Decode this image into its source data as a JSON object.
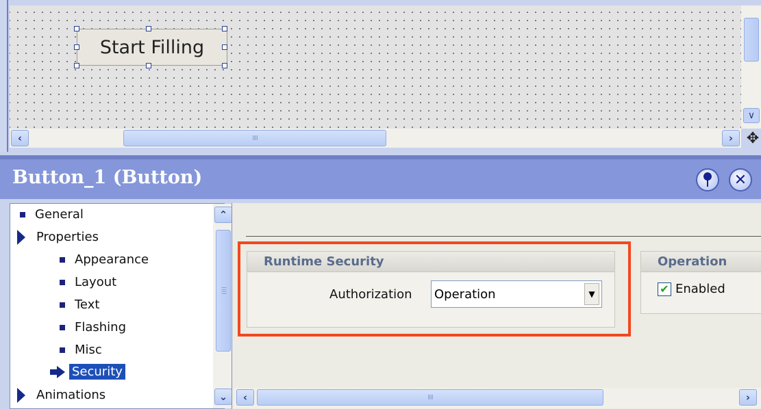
{
  "editor": {
    "canvas_button_label": "Start Filling",
    "scroll_grip": "IIII"
  },
  "panel": {
    "title": "Button_1 (Button)",
    "pin_icon": "pin-icon",
    "close_icon": "close-icon"
  },
  "tree": {
    "items": [
      {
        "label": "General",
        "icon": "bullet",
        "level": 0
      },
      {
        "label": "Properties",
        "icon": "expand-triangle",
        "level": 0
      },
      {
        "label": "Appearance",
        "icon": "bullet",
        "level": 1
      },
      {
        "label": "Layout",
        "icon": "bullet",
        "level": 1
      },
      {
        "label": "Text",
        "icon": "bullet",
        "level": 1
      },
      {
        "label": "Flashing",
        "icon": "bullet",
        "level": 1
      },
      {
        "label": "Misc",
        "icon": "bullet",
        "level": 1
      },
      {
        "label": "Security",
        "icon": "arrow-pointer",
        "level": 1,
        "selected": true
      },
      {
        "label": "Animations",
        "icon": "expand-triangle",
        "level": 0
      }
    ]
  },
  "security": {
    "group_title": "Runtime Security",
    "authorization_label": "Authorization",
    "authorization_value": "Operation"
  },
  "operation": {
    "group_title": "Operation",
    "enabled_label": "Enabled",
    "enabled_checked": true
  },
  "colors": {
    "panel_header": "#8597da",
    "highlight": "#f2481f",
    "selection": "#1d4fb8"
  }
}
